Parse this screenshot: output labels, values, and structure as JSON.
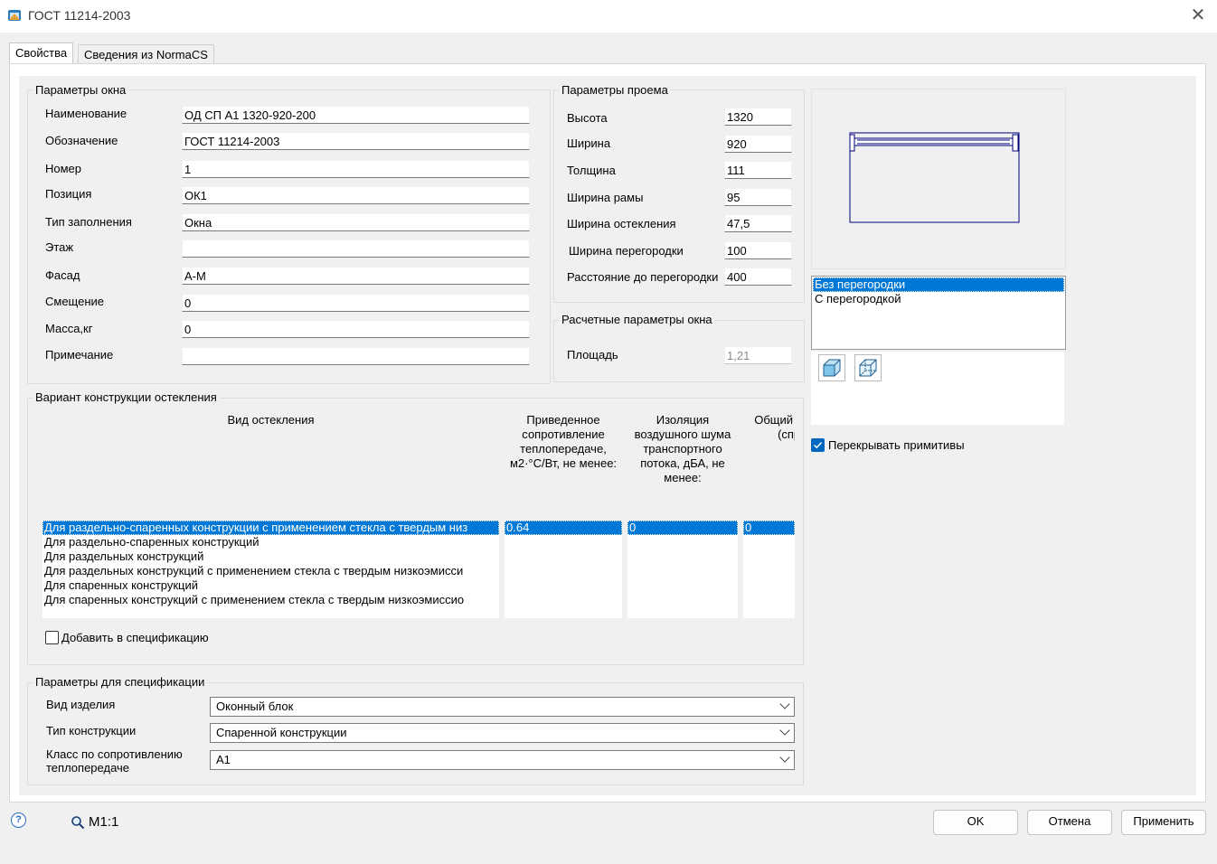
{
  "window": {
    "title": "ГОСТ 11214-2003"
  },
  "tabs": [
    {
      "label": "Свойства"
    },
    {
      "label": "Сведения из NormaCS"
    }
  ],
  "window_params": {
    "title": "Параметры окна",
    "rows": [
      {
        "label": "Наименование",
        "value": "ОД СП А1 1320-920-200"
      },
      {
        "label": "Обозначение",
        "value": "ГОСТ 11214-2003"
      },
      {
        "label": "Номер",
        "value": "1"
      },
      {
        "label": "Позиция",
        "value": "ОК1"
      },
      {
        "label": "Тип заполнения",
        "value": "Окна"
      },
      {
        "label": "Этаж",
        "value": ""
      },
      {
        "label": "Фасад",
        "value": "А-М"
      },
      {
        "label": "Смещение",
        "value": "0"
      },
      {
        "label": "Масса,кг",
        "value": "0"
      },
      {
        "label": "Примечание",
        "value": ""
      }
    ]
  },
  "opening_params": {
    "title": "Параметры проема",
    "rows": [
      {
        "label": "Высота",
        "value": "1320"
      },
      {
        "label": "Ширина",
        "value": "920"
      },
      {
        "label": "Толщина",
        "value": "111"
      },
      {
        "label": "Ширина рамы",
        "value": "95"
      },
      {
        "label": "Ширина остекления",
        "value": "47,5"
      },
      {
        "label": "Ширина перегородки",
        "value": "100"
      },
      {
        "label": "Расстояние до перегородки",
        "value": "400"
      }
    ]
  },
  "calc_params": {
    "title": "Расчетные параметры окна",
    "area_label": "Площадь",
    "area_value": "1,21"
  },
  "glazing": {
    "title": "Вариант конструкции остекления",
    "columns": [
      "Вид остекления",
      "Приведенное сопротивление теплопередаче, м2·°С/Вт, не менее:",
      "Изоляция воздушного шума транспортного потока, дБА, не менее:",
      "Общий к светог (спр зн"
    ],
    "rows": [
      "Для раздельно-спаренных конструкции с применением стекла с твердым низ",
      "Для раздельно-спаренных конструкций",
      "Для раздельных конструкций",
      "Для раздельных конструкций с применением стекла с твердым низкоэмисси",
      "Для спаренных конструкций",
      "Для спаренных конструкций с применением стекла с твердым низкоэмиссио"
    ],
    "selected_values": [
      "0.64",
      "0",
      "0"
    ],
    "add_to_spec_label": "Добавить в спецификацию",
    "add_to_spec_checked": false
  },
  "spec_params": {
    "title": "Параметры для спецификации",
    "rows": [
      {
        "label": "Вид изделия",
        "value": "Оконный блок"
      },
      {
        "label": "Тип конструкции",
        "value": "Спаренной конструкции"
      },
      {
        "label": "Класс по сопротивлению теплопередаче",
        "value": "А1"
      }
    ]
  },
  "partition_options": {
    "items": [
      "Без перегородки",
      "С перегородкой"
    ],
    "selected": 0
  },
  "overlap_primitives": {
    "label": "Перекрывать примитивы",
    "checked": true
  },
  "footer": {
    "scale": "М1:1",
    "ok": "OK",
    "cancel": "Отмена",
    "apply": "Применить"
  },
  "colors": {
    "selection": "#0078d7",
    "preview_stroke": "#00007a",
    "checkbox": "#0067c0"
  },
  "icons": [
    "app-icon",
    "close-icon",
    "view-3d-icon",
    "view-3d-alt-icon",
    "help-icon",
    "magnifier-icon",
    "chevron-down-icon"
  ]
}
